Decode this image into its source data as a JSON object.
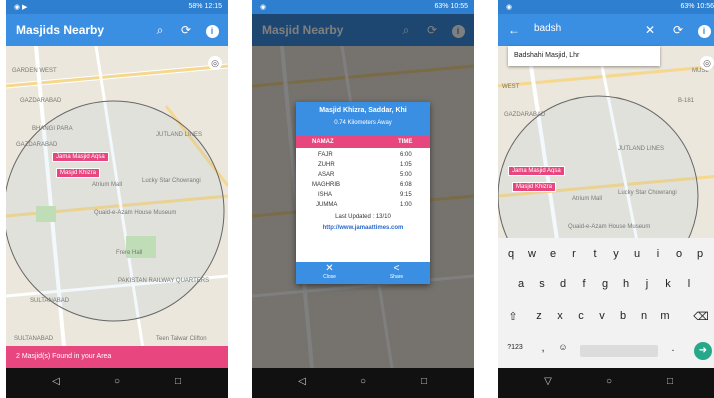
{
  "status": {
    "p1_time": "12:15",
    "p1_battery": "58%",
    "p2_time": "10:55",
    "p2_battery": "63%",
    "p3_time": "10:56",
    "p3_battery": "63%"
  },
  "colors": {
    "primary": "#3b8fe3",
    "accent": "#e8467f",
    "status_bar": "#2f7fd1"
  },
  "screen1": {
    "title": "Masjids Nearby",
    "icons": [
      "search-icon",
      "refresh-icon",
      "info-icon"
    ],
    "map_labels": [
      "GARDEN WEST",
      "GAZDARABAD",
      "BHANGI PARA",
      "GAZDARABAD",
      "JUTLAND LINES",
      "Lucky Star Chowrangi",
      "Atrium Mall",
      "Quaid-e-Azam House Museum",
      "PAKISTAN RAILWAY QUARTERS",
      "SULTANABAD",
      "SULTANABAD",
      "Teen Talwar Clifton",
      "Frere Hall"
    ],
    "markers": [
      "Jama Masjid Aqsa",
      "Masjid Khizra"
    ],
    "banner": "2 Masjid(s) Found in your Area"
  },
  "screen2": {
    "title": "Masjid Nearby",
    "dialog": {
      "name": "Masjid Khizra, Saddar, Khi",
      "distance": "0.74 Kilometers Away",
      "col_namaz": "NAMAZ",
      "col_time": "TIME",
      "rows": [
        {
          "namaz": "FAJR",
          "time": "6:00"
        },
        {
          "namaz": "ZUHR",
          "time": "1:05"
        },
        {
          "namaz": "ASAR",
          "time": "5:00"
        },
        {
          "namaz": "MAGHRIB",
          "time": "6:08"
        },
        {
          "namaz": "ISHA",
          "time": "9:15"
        },
        {
          "namaz": "JUMMA",
          "time": "1:00"
        }
      ],
      "last_updated": "Last Updated : 13/10",
      "link": "http://www.jamaattimes.com",
      "close_label": "Close",
      "share_label": "Share"
    }
  },
  "screen3": {
    "query": "badsh",
    "suggestion": "Badshahi Masjid, Lhr",
    "map_labels": [
      "WEST",
      "GAZDARABAD",
      "JUTLAND LINES",
      "Lucky Star Chowrangi",
      "Atrium Mall",
      "Quaid-e-Azam House Museum",
      "B-181",
      "MUSL"
    ],
    "markers": [
      "Jama Masjid Aqsa",
      "Masjid Khizra"
    ],
    "keyboard": {
      "row1": [
        "q",
        "w",
        "e",
        "r",
        "t",
        "y",
        "u",
        "i",
        "o",
        "p"
      ],
      "row2": [
        "a",
        "s",
        "d",
        "f",
        "g",
        "h",
        "j",
        "k",
        "l"
      ],
      "row3": [
        "z",
        "x",
        "c",
        "v",
        "b",
        "n",
        "m"
      ],
      "sym": "?123",
      "comma": ",",
      "period": "."
    }
  }
}
